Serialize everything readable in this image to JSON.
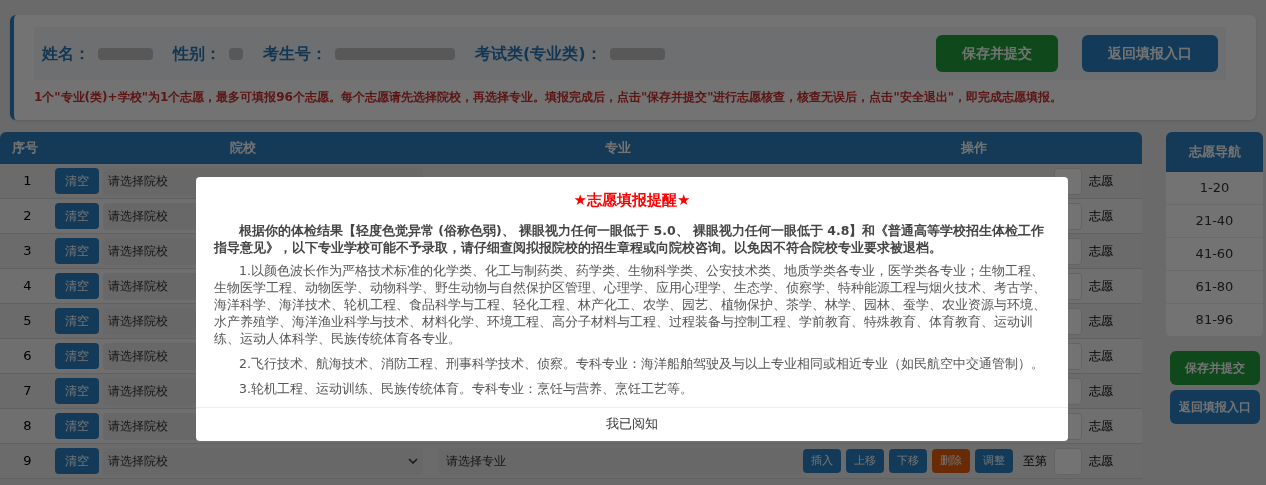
{
  "header": {
    "fields": [
      {
        "label": "姓名："
      },
      {
        "label": "性别："
      },
      {
        "label": "考生号："
      },
      {
        "label": "考试类(专业类)："
      }
    ],
    "buttons": [
      {
        "label": "保存并提交",
        "kind": "save"
      },
      {
        "label": "返回填报入口",
        "kind": "back"
      }
    ],
    "notice": "1个\"专业(类)+学校\"为1个志愿，最多可填报96个志愿。每个志愿请先选择院校，再选择专业。填报完成后，点击\"保存并提交\"进行志愿核查，核查无误后，点击\"安全退出\"，即完成志愿填报。"
  },
  "table": {
    "columns": [
      "序号",
      "院校",
      "专业",
      "操作"
    ],
    "rows": [
      {
        "index": "1",
        "clear": "清空",
        "school": "请选择院校",
        "suffix": "志愿"
      },
      {
        "index": "2",
        "clear": "清空",
        "school": "请选择院校",
        "suffix": "志愿"
      },
      {
        "index": "3",
        "clear": "清空",
        "school": "请选择院校",
        "suffix": "志愿"
      },
      {
        "index": "4",
        "clear": "清空",
        "school": "请选择院校",
        "suffix": "志愿"
      },
      {
        "index": "5",
        "clear": "清空",
        "school": "请选择院校",
        "suffix": "志愿"
      },
      {
        "index": "6",
        "clear": "清空",
        "school": "请选择院校",
        "suffix": "志愿"
      },
      {
        "index": "7",
        "clear": "清空",
        "school": "请选择院校",
        "suffix": "志愿"
      },
      {
        "index": "8",
        "clear": "清空",
        "school": "请选择院校",
        "suffix": "志愿"
      },
      {
        "index": "9",
        "clear": "清空",
        "school": "请选择院校",
        "major": "请选择专业",
        "actions": [
          {
            "label": "插入",
            "kind": "normal"
          },
          {
            "label": "上移",
            "kind": "normal"
          },
          {
            "label": "下移",
            "kind": "normal"
          },
          {
            "label": "删除",
            "kind": "danger"
          },
          {
            "label": "调整",
            "kind": "normal"
          }
        ],
        "to_label": "至第",
        "suffix": "志愿"
      }
    ]
  },
  "nav": {
    "title": "志愿导航",
    "items": [
      "1-20",
      "21-40",
      "41-60",
      "61-80",
      "81-96"
    ],
    "buttons": [
      {
        "label": "保存并提交",
        "kind": "save"
      },
      {
        "label": "返回填报入口",
        "kind": "back"
      }
    ]
  },
  "modal": {
    "title": "★志愿填报提醒★",
    "intro": "根据你的体检结果【轻度色觉异常 (俗称色弱)、 裸眼视力任何一眼低于 5.0、 裸眼视力任何一眼低于 4.8】和《普通高等学校招生体检工作指导意见》，以下专业学校可能不予录取，请仔细查阅拟报院校的招生章程或向院校咨询。以免因不符合院校专业要求被退档。",
    "items": [
      "1.以颜色波长作为严格技术标准的化学类、化工与制药类、药学类、生物科学类、公安技术类、地质学类各专业，医学类各专业；生物工程、生物医学工程、动物医学、动物科学、野生动物与自然保护区管理、心理学、应用心理学、生态学、侦察学、特种能源工程与烟火技术、考古学、海洋科学、海洋技术、轮机工程、食品科学与工程、轻化工程、林产化工、农学、园艺、植物保护、茶学、林学、园林、蚕学、农业资源与环境、水产养殖学、海洋渔业科学与技术、材料化学、环境工程、高分子材料与工程、过程装备与控制工程、学前教育、特殊教育、体育教育、运动训练、运动人体科学、民族传统体育各专业。",
      "2.飞行技术、航海技术、消防工程、刑事科学技术、侦察。专科专业：海洋船舶驾驶及与以上专业相同或相近专业（如民航空中交通管制）。",
      "3.轮机工程、运动训练、民族传统体育。专科专业：烹饪与营养、烹饪工艺等。"
    ],
    "confirm": "我已阅知"
  }
}
